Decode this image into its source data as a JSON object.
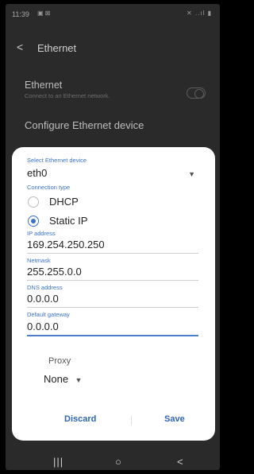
{
  "status_bar": {
    "time": "11:39",
    "left_icons": "▣ ⊠",
    "right_icons": "✕ ..ıl ▮"
  },
  "app_bar": {
    "back_glyph": "<",
    "title": "Ethernet"
  },
  "ethernet_setting": {
    "title": "Ethernet",
    "subtitle": "Connect to an Ethernet network.",
    "enabled": false
  },
  "configure_setting": {
    "title": "Configure Ethernet device"
  },
  "dialog": {
    "device_label": "Select Ethernet device",
    "device_value": "eth0",
    "dropdown_caret": "▼",
    "connection_type_label": "Connection type",
    "dhcp_label": "DHCP",
    "static_label": "Static IP",
    "ip_label": "IP address",
    "ip_value": "169.254.250.250",
    "netmask_label": "Netmask",
    "netmask_value": "255.255.0.0",
    "dns_label": "DNS address",
    "dns_value": "0.0.0.0",
    "gateway_label": "Default gateway",
    "gateway_value": "0.0.0.0",
    "proxy_label": "Proxy",
    "proxy_value": "None",
    "proxy_caret": "▼",
    "discard_label": "Discard",
    "save_label": "Save"
  },
  "nav_bar": {
    "recents": "|||",
    "home": "○",
    "back": "<"
  },
  "colors": {
    "accent": "#3a72c9",
    "button": "#2f66b8",
    "screen_bg": "#2a2a2a"
  }
}
